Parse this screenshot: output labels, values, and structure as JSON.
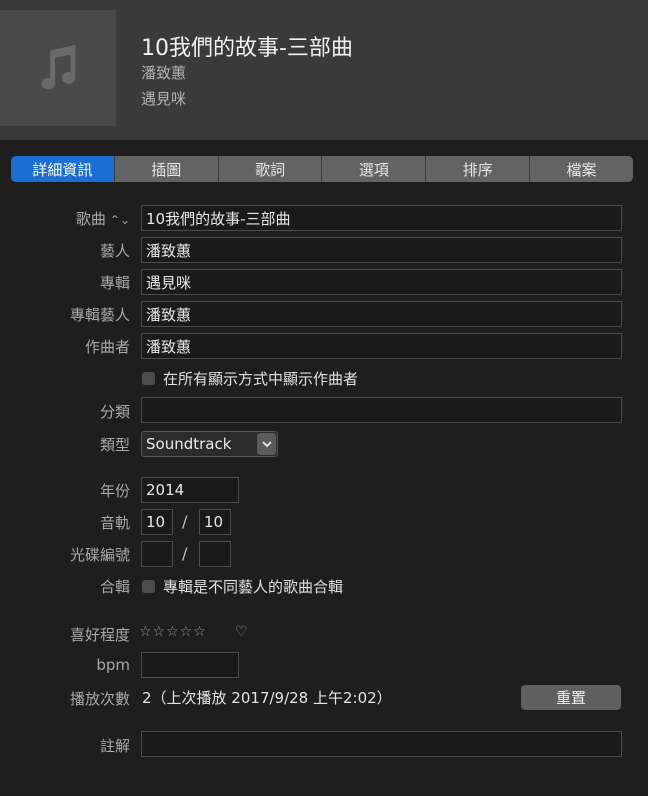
{
  "header": {
    "title": "10我們的故事-三部曲",
    "artist": "潘致蕙",
    "album": "遇見咪",
    "artwork_icon": "music-note-icon"
  },
  "tabs": [
    {
      "label": "詳細資訊",
      "active": true
    },
    {
      "label": "插圖"
    },
    {
      "label": "歌詞"
    },
    {
      "label": "選項"
    },
    {
      "label": "排序"
    },
    {
      "label": "檔案"
    }
  ],
  "form": {
    "song": {
      "label": "歌曲",
      "value": "10我們的故事-三部曲",
      "sort_icon": "⌃⌄"
    },
    "artist": {
      "label": "藝人",
      "value": "潘致蕙"
    },
    "album": {
      "label": "專輯",
      "value": "遇見咪"
    },
    "album_artist": {
      "label": "專輯藝人",
      "value": "潘致蕙"
    },
    "composer": {
      "label": "作曲者",
      "value": "潘致蕙"
    },
    "show_composer": {
      "text": "在所有顯示方式中顯示作曲者",
      "checked": false
    },
    "grouping": {
      "label": "分類",
      "value": ""
    },
    "genre": {
      "label": "類型",
      "value": "Soundtrack"
    },
    "year": {
      "label": "年份",
      "value": "2014"
    },
    "track": {
      "label": "音軌",
      "number": "10",
      "separator": "/",
      "of": "10"
    },
    "disc": {
      "label": "光碟編號",
      "number": "",
      "separator": "/",
      "of": ""
    },
    "compilation": {
      "label": "合輯",
      "text": "專輯是不同藝人的歌曲合輯",
      "checked": false
    },
    "rating": {
      "label": "喜好程度",
      "stars": "☆☆☆☆☆",
      "heart": "♡",
      "value": 0
    },
    "bpm": {
      "label": "bpm",
      "value": ""
    },
    "plays": {
      "label": "播放次數",
      "text": "2（上次播放 2017/9/28 上午2:02）"
    },
    "reset_button": "重置",
    "comments": {
      "label": "註解",
      "value": ""
    }
  },
  "colors": {
    "accent": "#1b6ed3",
    "background": "#1e1e1e",
    "header": "#3a3a3a"
  }
}
